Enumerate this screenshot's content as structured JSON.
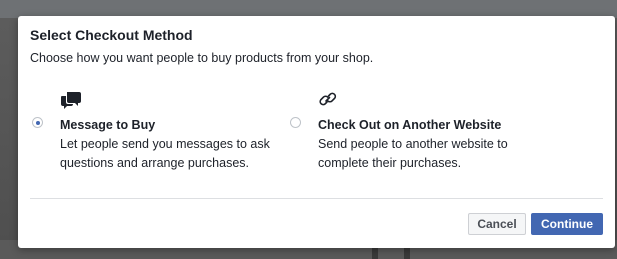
{
  "dialog": {
    "title": "Select Checkout Method",
    "subtitle": "Choose how you want people to buy products from your shop."
  },
  "options": [
    {
      "icon": "chat-bubbles-icon",
      "label": "Message to Buy",
      "description": "Let people send you messages to ask questions and arrange purchases.",
      "selected": true
    },
    {
      "icon": "link-icon",
      "label": "Check Out on Another Website",
      "description": "Send people to another website to complete their purchases.",
      "selected": false
    }
  ],
  "buttons": {
    "cancel": "Cancel",
    "continue": "Continue"
  },
  "colors": {
    "accent": "#4267b2",
    "text": "#1d2129",
    "divider": "#dddfe2"
  }
}
